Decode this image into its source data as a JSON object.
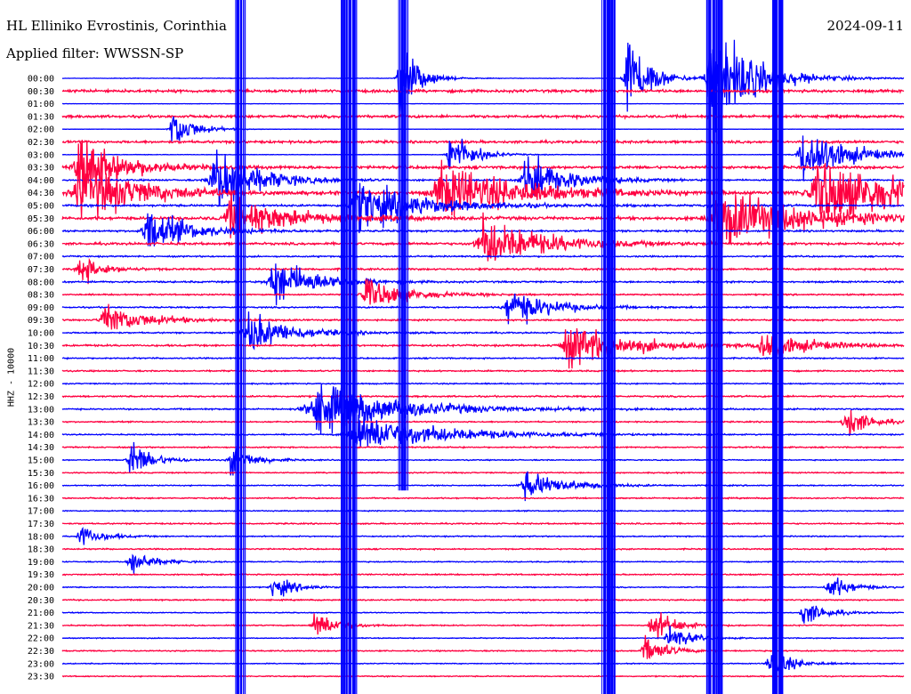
{
  "header": {
    "station": "HL Elliniko Evrostinis, Corinthia",
    "date": "2024-09-11",
    "filter": "Applied filter: WWSSN-SP"
  },
  "chart_data": {
    "type": "line",
    "title": "HL Elliniko Evrostinis, Corinthia",
    "ylabel": "HHZ - 10000",
    "yticks": [
      "00:00",
      "00:30",
      "01:00",
      "01:30",
      "02:00",
      "02:30",
      "03:00",
      "03:30",
      "04:00",
      "04:30",
      "05:00",
      "05:30",
      "06:00",
      "06:30",
      "07:00",
      "07:30",
      "08:00",
      "08:30",
      "09:00",
      "09:30",
      "10:00",
      "10:30",
      "11:00",
      "11:30",
      "12:00",
      "12:30",
      "13:00",
      "13:30",
      "14:00",
      "14:30",
      "15:00",
      "15:30",
      "16:00",
      "16:30",
      "17:00",
      "17:30",
      "18:00",
      "18:30",
      "19:00",
      "19:30",
      "20:00",
      "20:30",
      "21:00",
      "21:30",
      "22:00",
      "22:30",
      "23:00",
      "23:30"
    ],
    "colors": {
      "even": "#0000ff",
      "odd": "#ff0040"
    },
    "amplitude_scale": [
      0.2,
      1.05,
      0.15,
      1.0,
      0.1,
      0.95,
      0.2,
      1.05,
      0.6,
      1.0,
      0.8,
      1.15,
      0.7,
      0.9,
      0.55,
      0.7,
      0.65,
      0.55,
      0.55,
      0.6,
      0.55,
      0.7,
      0.5,
      0.55,
      0.45,
      0.6,
      0.55,
      0.5,
      0.45,
      0.5,
      0.4,
      0.45,
      0.4,
      0.5,
      0.4,
      0.5,
      0.45,
      0.5,
      0.4,
      0.5,
      0.4,
      0.5,
      0.35,
      0.45,
      0.35,
      0.45,
      0.35,
      0.4
    ],
    "events": [
      {
        "trace": 0,
        "x": 0.4,
        "amp": 40,
        "width": 0.008
      },
      {
        "trace": 0,
        "x": 0.67,
        "amp": 45,
        "width": 0.01
      },
      {
        "trace": 0,
        "x": 0.77,
        "amp": 50,
        "width": 0.02
      },
      {
        "trace": 4,
        "x": 0.13,
        "amp": 20,
        "width": 0.01
      },
      {
        "trace": 6,
        "x": 0.46,
        "amp": 25,
        "width": 0.01
      },
      {
        "trace": 6,
        "x": 0.88,
        "amp": 28,
        "width": 0.02
      },
      {
        "trace": 7,
        "x": 0.02,
        "amp": 30,
        "width": 0.02
      },
      {
        "trace": 8,
        "x": 0.18,
        "amp": 30,
        "width": 0.02
      },
      {
        "trace": 8,
        "x": 0.55,
        "amp": 22,
        "width": 0.02
      },
      {
        "trace": 9,
        "x": 0.02,
        "amp": 26,
        "width": 0.03
      },
      {
        "trace": 9,
        "x": 0.45,
        "amp": 24,
        "width": 0.04
      },
      {
        "trace": 9,
        "x": 0.9,
        "amp": 28,
        "width": 0.05
      },
      {
        "trace": 10,
        "x": 0.35,
        "amp": 22,
        "width": 0.03
      },
      {
        "trace": 11,
        "x": 0.2,
        "amp": 18,
        "width": 0.03
      },
      {
        "trace": 11,
        "x": 0.78,
        "amp": 26,
        "width": 0.04
      },
      {
        "trace": 12,
        "x": 0.1,
        "amp": 20,
        "width": 0.02
      },
      {
        "trace": 13,
        "x": 0.5,
        "amp": 22,
        "width": 0.03
      },
      {
        "trace": 15,
        "x": 0.02,
        "amp": 14,
        "width": 0.01
      },
      {
        "trace": 16,
        "x": 0.25,
        "amp": 22,
        "width": 0.02
      },
      {
        "trace": 17,
        "x": 0.36,
        "amp": 14,
        "width": 0.02
      },
      {
        "trace": 18,
        "x": 0.53,
        "amp": 16,
        "width": 0.02
      },
      {
        "trace": 19,
        "x": 0.05,
        "amp": 14,
        "width": 0.02
      },
      {
        "trace": 20,
        "x": 0.22,
        "amp": 18,
        "width": 0.02
      },
      {
        "trace": 21,
        "x": 0.6,
        "amp": 18,
        "width": 0.03
      },
      {
        "trace": 21,
        "x": 0.83,
        "amp": 14,
        "width": 0.02
      },
      {
        "trace": 26,
        "x": 0.3,
        "amp": 22,
        "width": 0.04
      },
      {
        "trace": 27,
        "x": 0.93,
        "amp": 16,
        "width": 0.01
      },
      {
        "trace": 28,
        "x": 0.35,
        "amp": 18,
        "width": 0.04
      },
      {
        "trace": 30,
        "x": 0.08,
        "amp": 18,
        "width": 0.01
      },
      {
        "trace": 30,
        "x": 0.2,
        "amp": 14,
        "width": 0.01
      },
      {
        "trace": 32,
        "x": 0.55,
        "amp": 12,
        "width": 0.02
      },
      {
        "trace": 36,
        "x": 0.02,
        "amp": 10,
        "width": 0.01
      },
      {
        "trace": 38,
        "x": 0.08,
        "amp": 12,
        "width": 0.01
      },
      {
        "trace": 40,
        "x": 0.25,
        "amp": 10,
        "width": 0.01
      },
      {
        "trace": 40,
        "x": 0.91,
        "amp": 12,
        "width": 0.01
      },
      {
        "trace": 42,
        "x": 0.88,
        "amp": 12,
        "width": 0.01
      },
      {
        "trace": 43,
        "x": 0.3,
        "amp": 14,
        "width": 0.01
      },
      {
        "trace": 43,
        "x": 0.7,
        "amp": 16,
        "width": 0.01
      },
      {
        "trace": 44,
        "x": 0.72,
        "amp": 12,
        "width": 0.01
      },
      {
        "trace": 45,
        "x": 0.69,
        "amp": 14,
        "width": 0.01
      },
      {
        "trace": 46,
        "x": 0.84,
        "amp": 14,
        "width": 0.01
      }
    ],
    "vertical_bursts": [
      {
        "x": 0.212,
        "top_trace": 0,
        "bottom_trace": 47,
        "intensity": 0.25
      },
      {
        "x": 0.34,
        "top_trace": 0,
        "bottom_trace": 47,
        "intensity": 0.5
      },
      {
        "x": 0.405,
        "top_trace": 0,
        "bottom_trace": 31,
        "intensity": 0.2
      },
      {
        "x": 0.65,
        "top_trace": 0,
        "bottom_trace": 47,
        "intensity": 0.4
      },
      {
        "x": 0.775,
        "top_trace": 0,
        "bottom_trace": 47,
        "intensity": 0.6
      },
      {
        "x": 0.85,
        "top_trace": 0,
        "bottom_trace": 47,
        "intensity": 0.3
      }
    ]
  }
}
